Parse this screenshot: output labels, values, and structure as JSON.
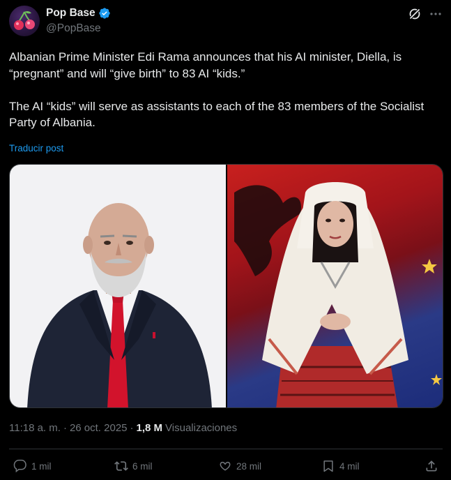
{
  "author": {
    "display_name": "Pop Base",
    "handle": "@PopBase",
    "verified": true,
    "avatar_icon": "cherry-avatar-icon"
  },
  "header_icons": [
    "grok-icon",
    "more-icon"
  ],
  "tweet": {
    "paragraphs": [
      "Albanian Prime Minister Edi Rama announces that his AI minister, Diella, is “pregnant” and will “give birth” to 83 AI “kids.”",
      "The AI “kids” will serve as assistants to each of the 83 members of the Socialist Party of Albania."
    ],
    "translate_label": "Traducir post"
  },
  "media": {
    "left_image": "man-in-suit-photo",
    "right_image": "woman-traditional-dress-flag-photo"
  },
  "meta": {
    "time": "11:18 a. m.",
    "separator": "·",
    "date": "26 oct. 2025",
    "views_count": "1,8 M",
    "views_label": "Visualizaciones"
  },
  "actions": {
    "replies": "1 mil",
    "reposts": "6 mil",
    "likes": "28 mil",
    "bookmarks": "4 mil"
  },
  "colors": {
    "background": "#000000",
    "text": "#e7e9ea",
    "muted": "#71767b",
    "link": "#1d9bf0",
    "verified": "#1d9bf0",
    "border": "#2f3336"
  }
}
